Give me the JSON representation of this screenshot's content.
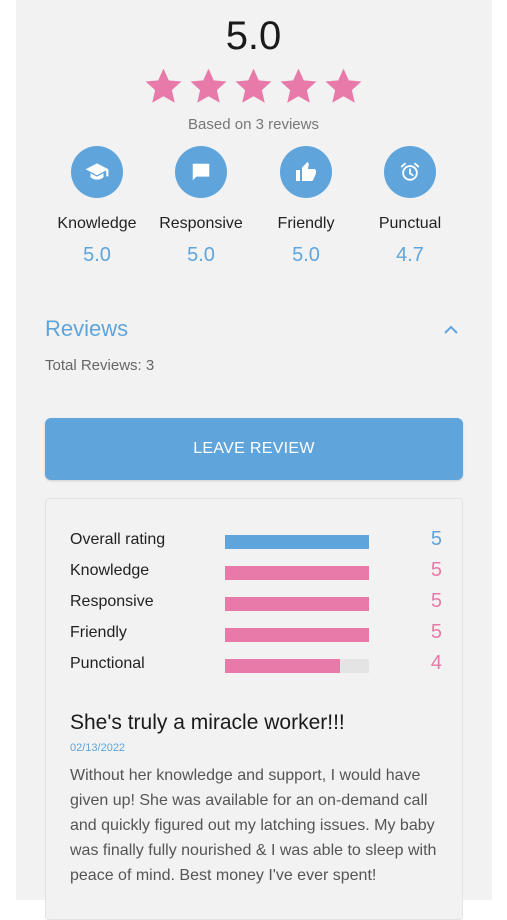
{
  "summary": {
    "score": "5.0",
    "stars": 5,
    "based_on": "Based on 3 reviews",
    "star_color": "#e87aa9"
  },
  "categories": [
    {
      "name": "Knowledge",
      "value": "5.0",
      "icon": "graduation-cap-icon"
    },
    {
      "name": "Responsive",
      "value": "5.0",
      "icon": "chat-bubble-icon"
    },
    {
      "name": "Friendly",
      "value": "5.0",
      "icon": "thumbs-up-icon"
    },
    {
      "name": "Punctual",
      "value": "4.7",
      "icon": "alarm-clock-icon"
    }
  ],
  "reviews": {
    "title": "Reviews",
    "total": "Total Reviews: 3",
    "leave_button": "LEAVE REVIEW"
  },
  "review": {
    "ratings": [
      {
        "label": "Overall rating",
        "value": 5,
        "display": "5",
        "color": "#5fa5db"
      },
      {
        "label": "Knowledge",
        "value": 5,
        "display": "5",
        "color": "#e87aa9"
      },
      {
        "label": "Responsive",
        "value": 5,
        "display": "5",
        "color": "#e87aa9"
      },
      {
        "label": "Friendly",
        "value": 5,
        "display": "5",
        "color": "#e87aa9"
      },
      {
        "label": "Punctional",
        "value": 4,
        "display": "4",
        "color": "#e87aa9"
      }
    ],
    "max_rating": 5,
    "title": "She's truly a miracle worker!!!",
    "date": "02/13/2022",
    "body": "Without her knowledge and support, I would have given up! She was available for an on-demand call and quickly figured out my latching issues. My baby was finally fully nourished & I was able to sleep with peace of mind. Best money I've ever spent!"
  },
  "colors": {
    "accent": "#5fa5db",
    "pink": "#e87aa9"
  }
}
